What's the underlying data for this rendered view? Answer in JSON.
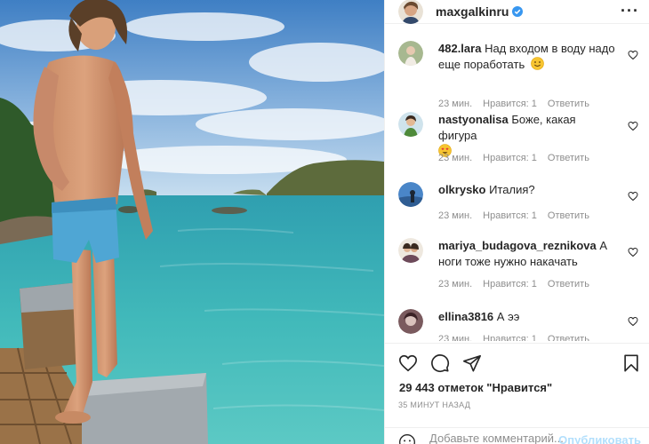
{
  "post": {
    "username": "maxgalkinru",
    "verified": true,
    "more_icon": "more-dots-icon"
  },
  "comments": [
    {
      "user": "482.lara",
      "text": "Над входом в воду надо еще поработать",
      "emoji": "smiling-face",
      "time": "23 мин.",
      "likes": "Нравится: 1",
      "reply": "Ответить"
    },
    {
      "user": "nastyonalisa",
      "text": "Боже, какая фигура",
      "emoji": "heart-eyes-face",
      "time": "23 мин.",
      "likes": "Нравится: 1",
      "reply": "Ответить"
    },
    {
      "user": "olkrysko",
      "text": "Италия?",
      "emoji": "",
      "time": "23 мин.",
      "likes": "Нравится: 1",
      "reply": "Ответить"
    },
    {
      "user": "mariya_budagova_reznikova",
      "text": "А ноги тоже нужно накачать",
      "emoji": "",
      "time": "23 мин.",
      "likes": "Нравится: 1",
      "reply": "Ответить"
    },
    {
      "user": "ellina3816",
      "text": "А ээ",
      "emoji": "",
      "time": "23 мин.",
      "likes": "Нравится: 1",
      "reply": "Ответить"
    }
  ],
  "actions": {
    "likes_text": "29 443 отметок \"Нравится\"",
    "posted_ago": "35 МИНУТ НАЗАД"
  },
  "add_comment": {
    "placeholder": "Добавьте комментарий...",
    "publish_label": "Опубликовать"
  },
  "colors": {
    "text": "#262626",
    "secondary": "#8e8e8e",
    "verified_blue": "#3897f0",
    "publish_disabled": "#b2dffc"
  }
}
